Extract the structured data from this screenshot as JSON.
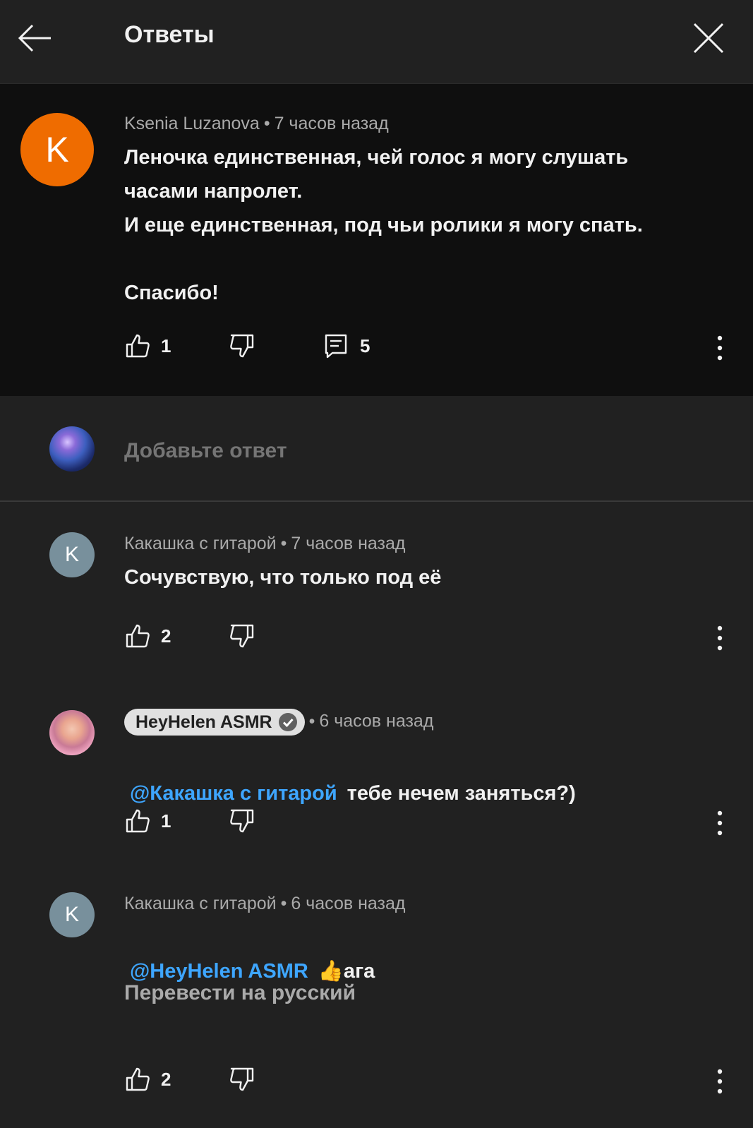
{
  "header": {
    "title": "Ответы"
  },
  "main_comment": {
    "avatar_letter": "K",
    "author": "Ksenia Luzanova",
    "time": "7 часов назад",
    "text": "Леночка единственная, чей голос я могу слушать\nчасами напролет.\nИ еще единственная, под чьи ролики я могу спать.\n\nСпасибо!",
    "likes": "1",
    "replies": "5"
  },
  "reply_box": {
    "placeholder": "Добавьте ответ"
  },
  "replies": [
    {
      "avatar_letter": "K",
      "author": "Какашка с гитарой",
      "time": "7 часов назад",
      "text": "Сочувствую, что только под её",
      "likes": "2"
    },
    {
      "author": "HeyHelen ASMR",
      "time": "6 часов назад",
      "mention": "@Какашка с гитарой",
      "text": "тебе нечем заняться?)",
      "likes": "1"
    },
    {
      "avatar_letter": "K",
      "author": "Какашка с гитарой",
      "time": "6 часов назад",
      "mention": "@HeyHelen ASMR",
      "text": "👍ага",
      "translate": "Перевести на русский",
      "likes": "2"
    }
  ],
  "colors": {
    "accent_orange": "#ef6c00",
    "mention_blue": "#3ea6ff",
    "avatar_grey": "#78909c"
  }
}
